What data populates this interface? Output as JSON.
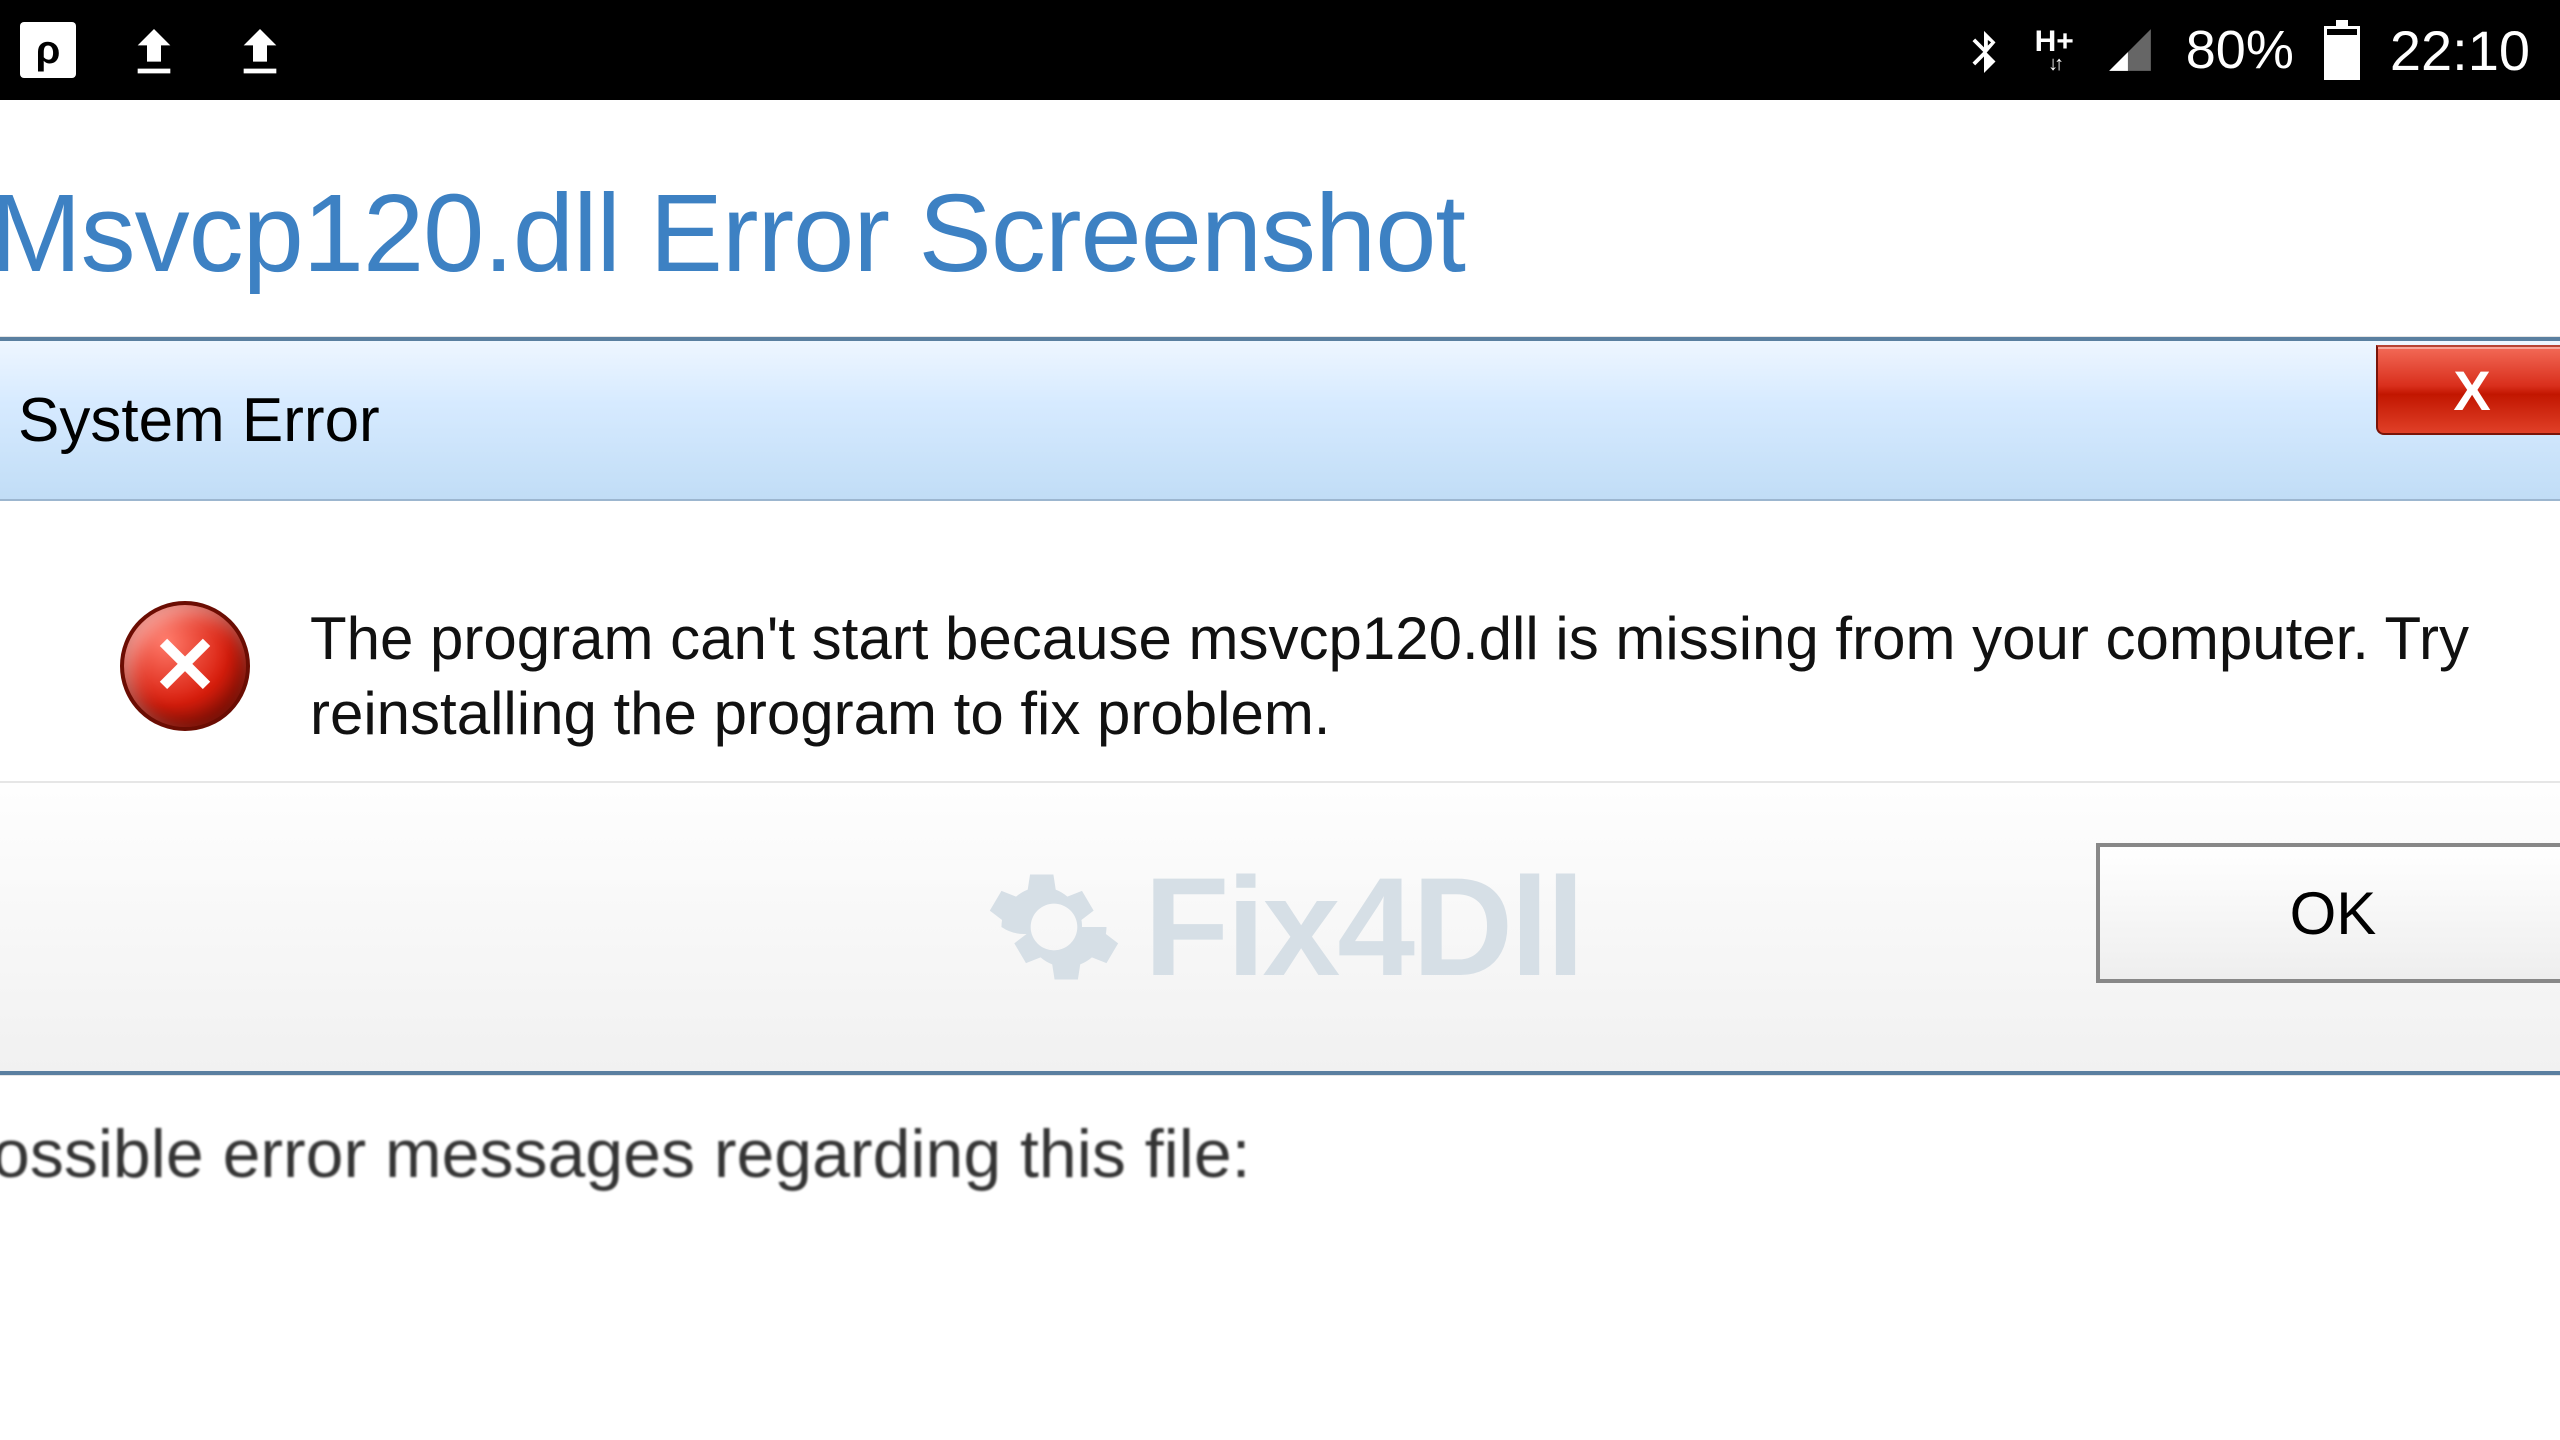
{
  "statusbar": {
    "app_icon_glyph": "ρ",
    "battery_pct": "80%",
    "clock": "22:10",
    "hplus_top": "H+",
    "hplus_bottom": "↓↑"
  },
  "page": {
    "heading": "Msvcp120.dll Error Screenshot",
    "cutoff_text": "ossible error messages regarding this file:"
  },
  "dialog": {
    "title": "System Error",
    "close_glyph": "X",
    "error_glyph": "✕",
    "message": "The program can't start because msvcp120.dll is missing from your computer. Try reinstalling the program to fix problem.",
    "watermark": "Fix4Dll",
    "ok_label": "OK"
  }
}
